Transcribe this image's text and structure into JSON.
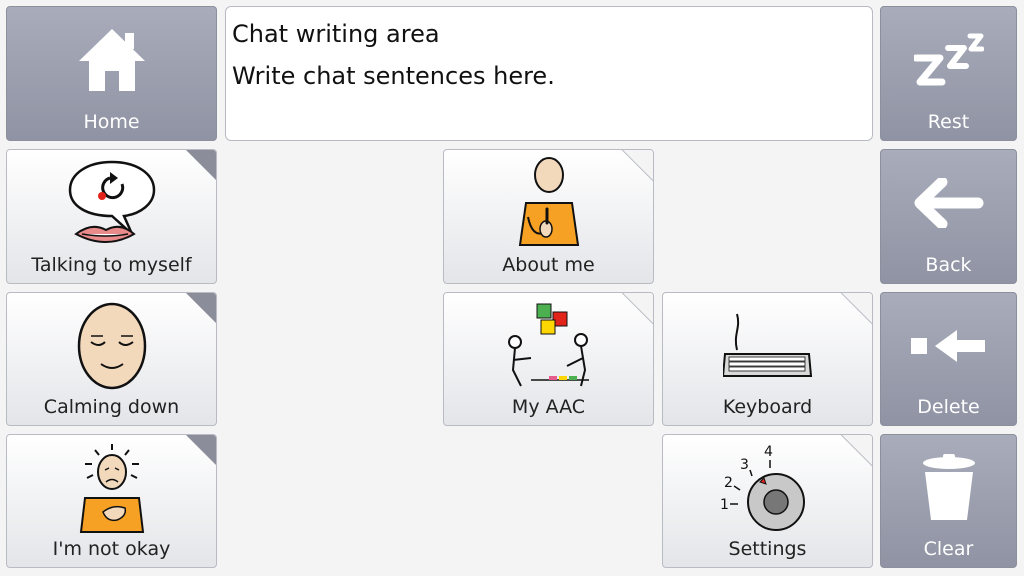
{
  "chat": {
    "title": "Chat writing area",
    "placeholder": "Write chat sentences here."
  },
  "nav": {
    "home": {
      "label": "Home",
      "icon": "home-icon"
    },
    "rest": {
      "label": "Rest",
      "icon": "zzz-icon"
    },
    "back": {
      "label": "Back",
      "icon": "arrow-left-icon"
    },
    "delete": {
      "label": "Delete",
      "icon": "backspace-icon"
    },
    "clear": {
      "label": "Clear",
      "icon": "trash-icon"
    }
  },
  "tiles": {
    "talking": {
      "label": "Talking to myself",
      "icon": "talking-to-myself-icon"
    },
    "calming": {
      "label": "Calming down",
      "icon": "calm-face-icon"
    },
    "not_okay": {
      "label": "I'm not okay",
      "icon": "not-okay-person-icon"
    },
    "about_me": {
      "label": "About me",
      "icon": "person-pointing-self-icon"
    },
    "my_aac": {
      "label": "My AAC",
      "icon": "aac-conversation-icon"
    },
    "keyboard": {
      "label": "Keyboard",
      "icon": "keyboard-icon"
    },
    "settings": {
      "label": "Settings",
      "icon": "dial-icon",
      "dial_numbers": [
        "1",
        "2",
        "3",
        "4"
      ]
    }
  },
  "colors": {
    "nav_tile": "#9b9eac",
    "content_tile": "#f0f1f3",
    "background": "#f4f4f5",
    "accent_orange": "#f7a124",
    "skin": "#f3d9bc"
  }
}
